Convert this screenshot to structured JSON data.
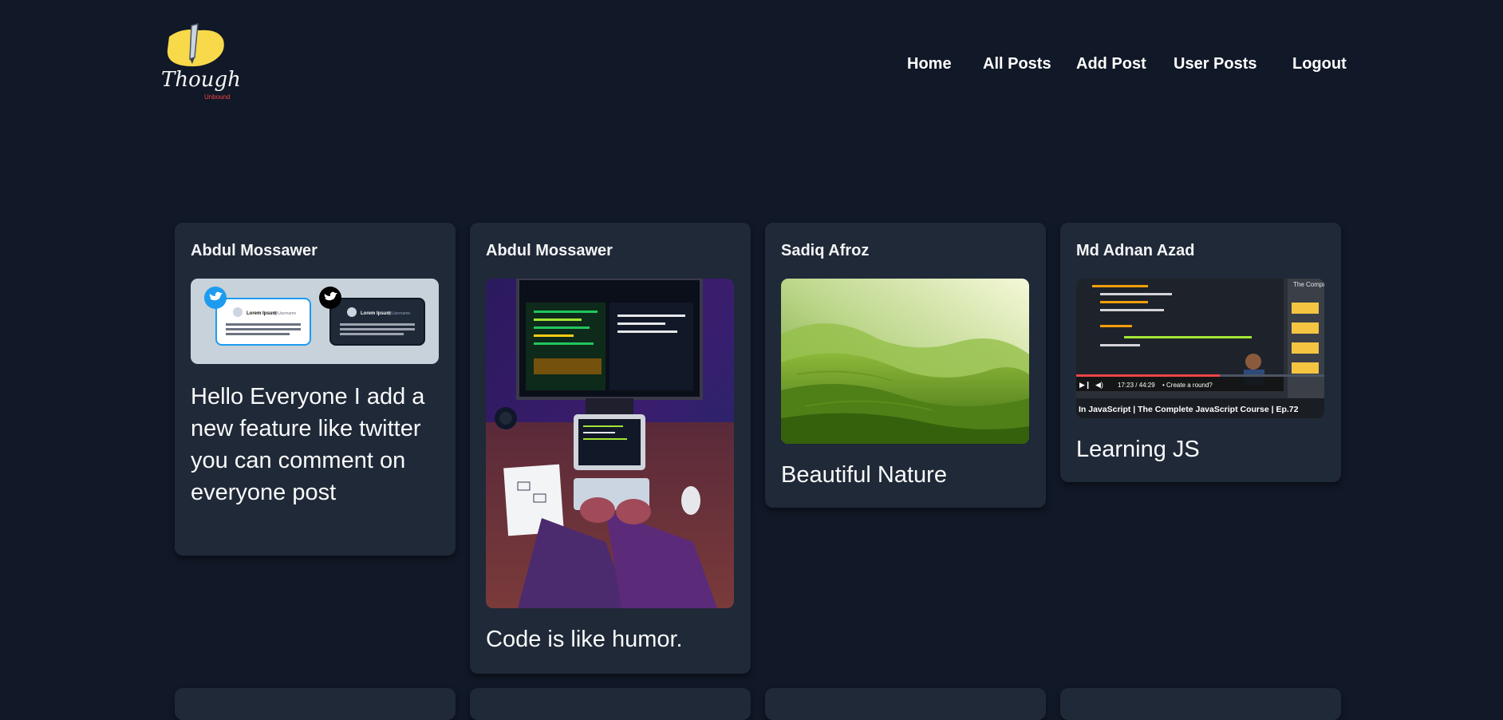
{
  "header": {
    "logo_text": "Thoughts",
    "logo_subtext": "Unbound",
    "nav": {
      "home": "Home",
      "all_posts": "All Posts",
      "add_post": "Add Post",
      "user_posts": "User Posts",
      "logout": "Logout"
    }
  },
  "posts": [
    {
      "author": "Abdul Mossawer",
      "title": "Hello Everyone I add a new feature like twitter you can comment on everyone post",
      "image": {
        "tweet_name": "Lorem Ipsum",
        "tweet_handle": "@Username",
        "tweet_text": "Lorem ipsum dolor sit amet, consectetur adipiscing elit, sed diam nonummy nibh euismod tincidunt ut laoreet dolore magna aliquam erat volutpat."
      }
    },
    {
      "author": "Abdul Mossawer",
      "title": "Code is like humor."
    },
    {
      "author": "Sadiq Afroz",
      "title": "Beautiful Nature"
    },
    {
      "author": "Md Adnan Azad",
      "title": "Learning JS",
      "image": {
        "video_time": "17:23 / 44:29",
        "video_chapter": "• Create a round?",
        "video_caption": "In JavaScript | The Complete JavaScript Course | Ep.72",
        "side_caption": "The Complete"
      }
    }
  ]
}
